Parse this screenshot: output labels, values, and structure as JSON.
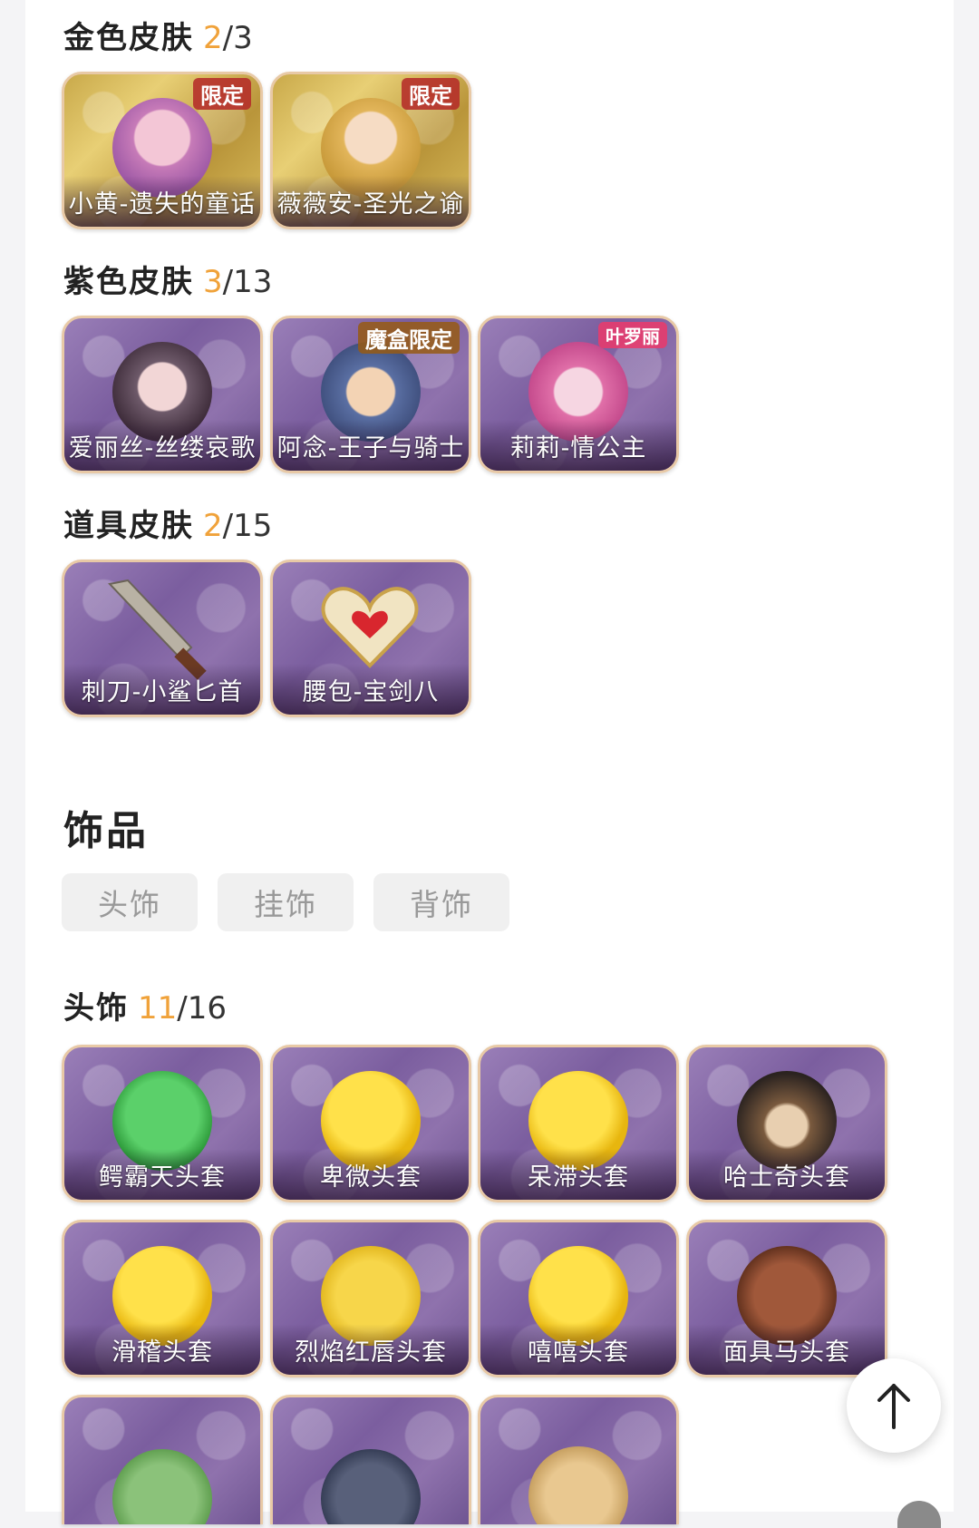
{
  "sections": {
    "gold": {
      "title": "金色皮肤",
      "owned": "2",
      "total": "/3",
      "items": [
        {
          "label": "小黄-遗失的童话",
          "badge": "限定"
        },
        {
          "label": "薇薇安-圣光之谕",
          "badge": "限定"
        }
      ]
    },
    "purple": {
      "title": "紫色皮肤",
      "owned": "3",
      "total": "/13",
      "items": [
        {
          "label": "爱丽丝-丝缕哀歌",
          "badge": ""
        },
        {
          "label": "阿念-王子与骑士",
          "badge": "魔盒限定"
        },
        {
          "label": "莉莉-情公主",
          "badge": "叶罗丽"
        }
      ]
    },
    "props": {
      "title": "道具皮肤",
      "owned": "2",
      "total": "/15",
      "items": [
        {
          "label": "刺刀-小鲨匕首"
        },
        {
          "label": "腰包-宝剑八"
        }
      ]
    },
    "headwear": {
      "title": "头饰",
      "owned": "11",
      "total": "/16",
      "items": [
        {
          "label": "鳄霸天头套"
        },
        {
          "label": "卑微头套"
        },
        {
          "label": "呆滞头套"
        },
        {
          "label": "哈士奇头套"
        },
        {
          "label": "滑稽头套"
        },
        {
          "label": "烈焰红唇头套"
        },
        {
          "label": "嘻嘻头套"
        },
        {
          "label": "面具马头套"
        }
      ]
    }
  },
  "accessories": {
    "title": "饰品",
    "tabs": [
      "头饰",
      "挂饰",
      "背饰"
    ]
  },
  "icons": {
    "back_to_top": "arrow-up-icon"
  }
}
